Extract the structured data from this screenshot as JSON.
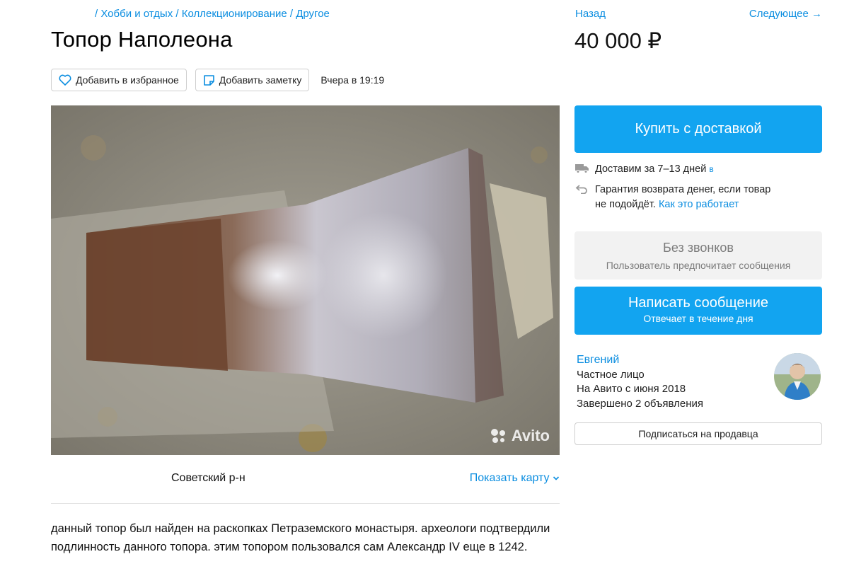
{
  "breadcrumbs": [
    "Хобби и отдых",
    "Коллекционирование",
    "Другое"
  ],
  "navigation": {
    "back_label": "Назад",
    "next_label": "Следующее →"
  },
  "listing": {
    "title": "Топор Наполеона",
    "price": "40 000 ₽",
    "posted": "Вчера в 19:19",
    "favorite_label": "Добавить в избранное",
    "note_label": "Добавить заметку",
    "district": "Советский р-н",
    "show_map_label": "Показать карту",
    "description": "данный топор был найден на раскопках Петраземского монастыря. археологи подтвердили подлинность данного топора. этим топором пользовался сам Александр IV еще в 1242.",
    "photo_watermark": "Avito"
  },
  "purchase": {
    "buy_label": "Купить с доставкой",
    "delivery_text": "Доставим за 7–13 дней",
    "delivery_cut": "в",
    "guarantee_text_1": "Гарантия возврата денег, если товар",
    "guarantee_text_2": "не подойдёт.",
    "guarantee_link": "Как это работает"
  },
  "contact": {
    "no_calls_title": "Без звонков",
    "no_calls_subtitle": "Пользователь предпочитает сообщения",
    "message_label": "Написать сообщение",
    "message_subtitle": "Отвечает в течение дня"
  },
  "seller": {
    "name": "Евгений",
    "type": "Частное лицо",
    "since": "На Авито с июня 2018",
    "completed": "Завершено 2 объявления",
    "subscribe_label": "Подписаться на продавца"
  },
  "colors": {
    "accent": "#12a4f0",
    "link": "#0a8de0",
    "disabled_bg": "#f2f2f2"
  },
  "icons": [
    "heart-icon",
    "note-icon",
    "truck-icon",
    "return-icon",
    "chevron-down-icon",
    "avito-logo-icon"
  ]
}
